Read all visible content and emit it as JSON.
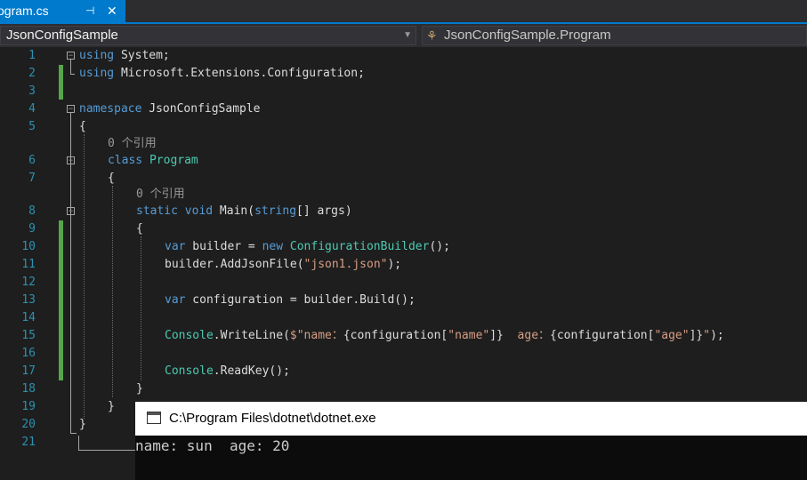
{
  "tab": {
    "name": "ogram.cs",
    "pin": "⊣",
    "close": "✕"
  },
  "nav": {
    "project": "JsonConfigSample",
    "member": "JsonConfigSample.Program",
    "dropdown": "▼",
    "class_icon": "⚘"
  },
  "gutter": [
    "1",
    "2",
    "3",
    "4",
    "5",
    "6",
    "7",
    "8",
    "9",
    "10",
    "11",
    "12",
    "13",
    "14",
    "15",
    "16",
    "17",
    "18",
    "19",
    "20",
    "21"
  ],
  "codelens": [
    "0 个引用",
    "0 个引用"
  ],
  "code": {
    "l1": {
      "kw": "using",
      "rest": " System;"
    },
    "l2": {
      "kw": "using",
      "rest": " Microsoft.Extensions.Configuration;"
    },
    "l4": {
      "kw": "namespace",
      "rest": " JsonConfigSample"
    },
    "l5": "{",
    "l6": {
      "kw": "class",
      "ty": "Program"
    },
    "l7": "{",
    "l8": {
      "kw": "static void",
      "rest": " Main(",
      "kw2": "string",
      "rest2": "[] args)"
    },
    "l9": "{",
    "l10": {
      "kw": "var",
      "rest": " builder = ",
      "kw2": "new",
      "ty": "ConfigurationBuilder",
      "rest2": "();"
    },
    "l11": {
      "rest": "builder.AddJsonFile(",
      "st": "\"json1.json\"",
      "rest2": ");"
    },
    "l13": {
      "kw": "var",
      "rest": " configuration = builder.Build();"
    },
    "l15": {
      "ty": "Console",
      "rest": ".WriteLine(",
      "st": "$\"name：",
      "rest2": "{configuration[",
      "st2": "\"name\"",
      "rest3": "]}",
      "st3": "  age：",
      "rest4": "{configuration[",
      "st4": "\"age\"",
      "rest5": "]}",
      "st5": "\"",
      "rest6": ");"
    },
    "l17": {
      "ty": "Console",
      "rest": ".ReadKey();"
    },
    "l18": "}",
    "l19": "}",
    "l20": "}"
  },
  "console": {
    "title": "C:\\Program Files\\dotnet\\dotnet.exe",
    "output": "name: sun  age: 20"
  }
}
